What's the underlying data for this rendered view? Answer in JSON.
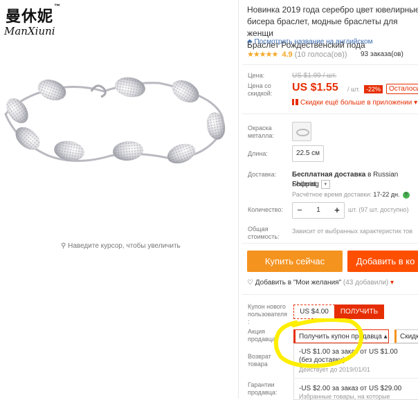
{
  "brand": {
    "cn": "曼休妮",
    "tm": "™",
    "en": "ManXiuni"
  },
  "zoom_hint": "Наведите курсор, чтобы увеличить",
  "product": {
    "title_l1": "Новинка 2019 года серебро цвет ювелирные",
    "title_l2": "бисера браслет, модные браслеты для женщи",
    "title_l3": "Браслет Рождественский пода",
    "translate_link": "Посмотреть название на английском",
    "stars": "★★★★★",
    "rating": "4.9",
    "votes": "(10 голоса(ов))",
    "orders": "93 заказа(ов)"
  },
  "price": {
    "label": "Цена:",
    "old": "US $1.99 / шт.",
    "discount_label_l1": "Цена со",
    "discount_label_l2": "скидкой:",
    "value": "US $1.55",
    "unit": "/ шт.",
    "badge": "-22%",
    "remaining": "Осталось",
    "app_discount": "Скидки ещё больше в приложении"
  },
  "options": {
    "color_label_l1": "Окраска",
    "color_label_l2": "металла:",
    "length_label": "Длина:",
    "length_value": "22.5 см"
  },
  "shipping": {
    "label": "Доставка:",
    "free": "Бесплатная доставка",
    "to": "в Russian Federat",
    "method": "Shipping",
    "time_label": "Расчётное время доставки:",
    "time_value": "17-22 дн.",
    "help": "?"
  },
  "quantity": {
    "label": "Количество:",
    "minus": "−",
    "value": "1",
    "plus": "+",
    "available": "шт. (97 шт. доступно)"
  },
  "total": {
    "label_l1": "Общая",
    "label_l2": "стоимость:",
    "note": "Зависит от выбранных характеристик тов"
  },
  "actions": {
    "buy_now": "Купить сейчас",
    "add_to_cart": "Добавить в ко",
    "wishlist": "Добавить в \"Мои желания\"",
    "wish_count": "(43 добавили)"
  },
  "coupons": {
    "new_user_l1": "Купон нового",
    "new_user_l2": "пользователя",
    "new_user_l3": ":",
    "new_user_value": "US $4.00",
    "get": "ПОЛУЧИТЬ",
    "seller_label_l1": "Акция",
    "seller_label_l2": "продавца:",
    "seller_coupon": "Получить купон продавца",
    "seller_extra": "Скидк",
    "return_l1": "Возврат",
    "return_l2": "товара",
    "guarantee_l1": "Гарантии",
    "guarantee_l2": "продавца:",
    "c1_line1": "-US $1.00 за заказ от US $1.00",
    "c1_line2": "(без доставки)",
    "c1_valid": "Действует до 2019/01/01",
    "c2_line1": "-US $2.00 за заказ от US $29.00",
    "c2_line2": "Избранные товары, на которые"
  },
  "colors": {
    "accent": "#e62e04",
    "buy": "#f5931f",
    "cart": "#ff4f00",
    "highlight": "#ffee00",
    "link": "#3b6db3"
  }
}
